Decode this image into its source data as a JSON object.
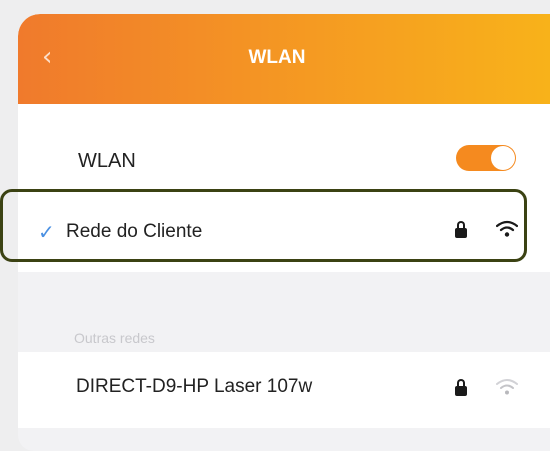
{
  "header": {
    "back_icon": "chevron-left-icon",
    "title": "WLAN"
  },
  "wlan": {
    "label": "WLAN",
    "enabled": true,
    "accent": "#f58a1f"
  },
  "connected_network": {
    "name": "Rede do Cliente",
    "check_icon": "checkmark-icon",
    "check_color": "#4a90e2",
    "secured": true,
    "signal_icon": "wifi-icon",
    "signal_strength": "strong"
  },
  "other_networks": {
    "section_label": "Outras redes",
    "items": [
      {
        "name": "DIRECT-D9-HP Laser 107w",
        "secured": true,
        "signal_icon": "wifi-icon",
        "signal_strength": "weak"
      }
    ]
  },
  "colors": {
    "header_start": "#f07a2c",
    "header_end": "#f8b21a",
    "highlight_border": "#3b4213"
  }
}
